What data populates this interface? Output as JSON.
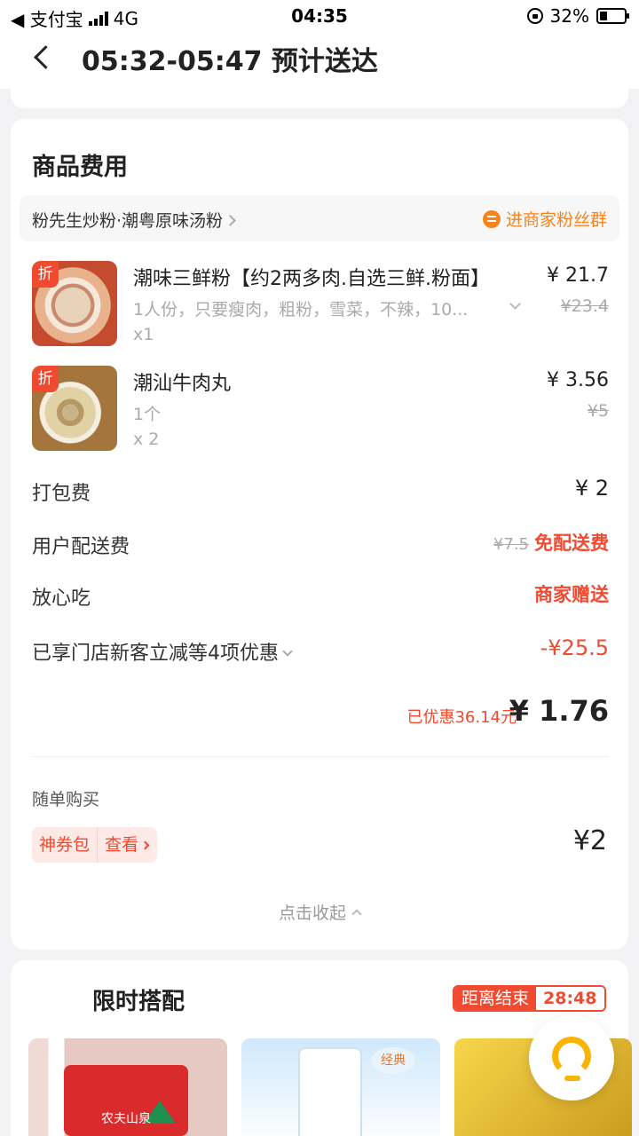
{
  "status_bar": {
    "carrier": "◀ 支付宝",
    "network": "4G",
    "time": "04:35",
    "battery": "32%",
    "battery_level": 0.32
  },
  "nav": {
    "title": "05:32-05:47 预计送达"
  },
  "fees": {
    "section_title": "商品费用",
    "shop_name": "粉先生炒粉·潮粤原味汤粉",
    "fans_group": "进商家粉丝群",
    "items": [
      {
        "badge": "折",
        "name": "潮味三鲜粉【约2两多肉.自选三鲜.粉面】",
        "spec": "1人份，只要瘦肉，粗粉，雪菜，不辣，10...",
        "qty": "x1",
        "price": "¥ 21.7",
        "original_price": "¥23.4"
      },
      {
        "badge": "折",
        "name": "潮汕牛肉丸",
        "spec": "1个",
        "qty": "x 2",
        "price": "¥ 3.56",
        "original_price": "¥5"
      }
    ],
    "packing": {
      "label": "打包费",
      "value": "¥ 2"
    },
    "delivery": {
      "label": "用户配送费",
      "original": "¥7.5",
      "value": "免配送费"
    },
    "safe_eat": {
      "label": "放心吃",
      "value": "商家赠送"
    },
    "discount": {
      "label": "已享门店新客立减等4项优惠",
      "value": "-¥25.5"
    },
    "saved": "已优惠36.14元",
    "total": "¥ 1.76"
  },
  "addon": {
    "title": "随单购买",
    "coupon_tag": "神券包",
    "view": "查看",
    "price": "¥2",
    "collapse": "点击收起"
  },
  "combo": {
    "title": "限时搭配",
    "timer_label": "距离结束",
    "timer_value": "28:48",
    "product1_text": "农夫山泉",
    "product2_stamp": "经典"
  },
  "colors": {
    "accent_red": "#f04a31",
    "orange": "#f5841f",
    "service_yellow": "#f8b400"
  }
}
